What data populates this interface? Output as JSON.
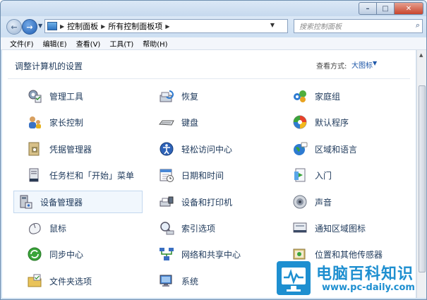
{
  "window": {
    "minimize_glyph": "–",
    "maximize_glyph": "□",
    "close_glyph": "✕"
  },
  "nav": {
    "back_glyph": "←",
    "forward_glyph": "→",
    "breadcrumbs": [
      "控制面板",
      "所有控制面板项"
    ],
    "search_placeholder": "搜索控制面板"
  },
  "menu": [
    "文件(F)",
    "编辑(E)",
    "查看(V)",
    "工具(T)",
    "帮助(H)"
  ],
  "header": {
    "title": "调整计算机的设置",
    "view_by_label": "查看方式:",
    "view_by_value": "大图标"
  },
  "items": [
    {
      "label": "管理工具",
      "icon": "admin-tools-icon",
      "selected": false
    },
    {
      "label": "恢复",
      "icon": "recovery-icon",
      "selected": false
    },
    {
      "label": "家庭组",
      "icon": "homegroup-icon",
      "selected": false
    },
    {
      "label": "家长控制",
      "icon": "parental-controls-icon",
      "selected": false
    },
    {
      "label": "键盘",
      "icon": "keyboard-icon",
      "selected": false
    },
    {
      "label": "默认程序",
      "icon": "default-programs-icon",
      "selected": false
    },
    {
      "label": "凭据管理器",
      "icon": "credential-manager-icon",
      "selected": false
    },
    {
      "label": "轻松访问中心",
      "icon": "ease-of-access-icon",
      "selected": false
    },
    {
      "label": "区域和语言",
      "icon": "region-language-icon",
      "selected": false
    },
    {
      "label": "任务栏和「开始」菜单",
      "icon": "taskbar-start-menu-icon",
      "selected": false
    },
    {
      "label": "日期和时间",
      "icon": "date-time-icon",
      "selected": false
    },
    {
      "label": "入门",
      "icon": "getting-started-icon",
      "selected": false
    },
    {
      "label": "设备管理器",
      "icon": "device-manager-icon",
      "selected": true
    },
    {
      "label": "设备和打印机",
      "icon": "devices-printers-icon",
      "selected": false
    },
    {
      "label": "声音",
      "icon": "sound-icon",
      "selected": false
    },
    {
      "label": "鼠标",
      "icon": "mouse-icon",
      "selected": false
    },
    {
      "label": "索引选项",
      "icon": "indexing-options-icon",
      "selected": false
    },
    {
      "label": "通知区域图标",
      "icon": "notification-area-icon",
      "selected": false
    },
    {
      "label": "同步中心",
      "icon": "sync-center-icon",
      "selected": false
    },
    {
      "label": "网络和共享中心",
      "icon": "network-sharing-icon",
      "selected": false
    },
    {
      "label": "位置和其他传感器",
      "icon": "location-sensors-icon",
      "selected": false
    },
    {
      "label": "文件夹选项",
      "icon": "folder-options-icon",
      "selected": false
    },
    {
      "label": "系统",
      "icon": "system-icon",
      "selected": false
    }
  ],
  "watermark": {
    "title": "电脑百科知识",
    "url": "www.pc-daily.com"
  },
  "colors": {
    "link_text": "#1e395b",
    "accent": "#1e57a8",
    "watermark": "#1e8fd0"
  }
}
